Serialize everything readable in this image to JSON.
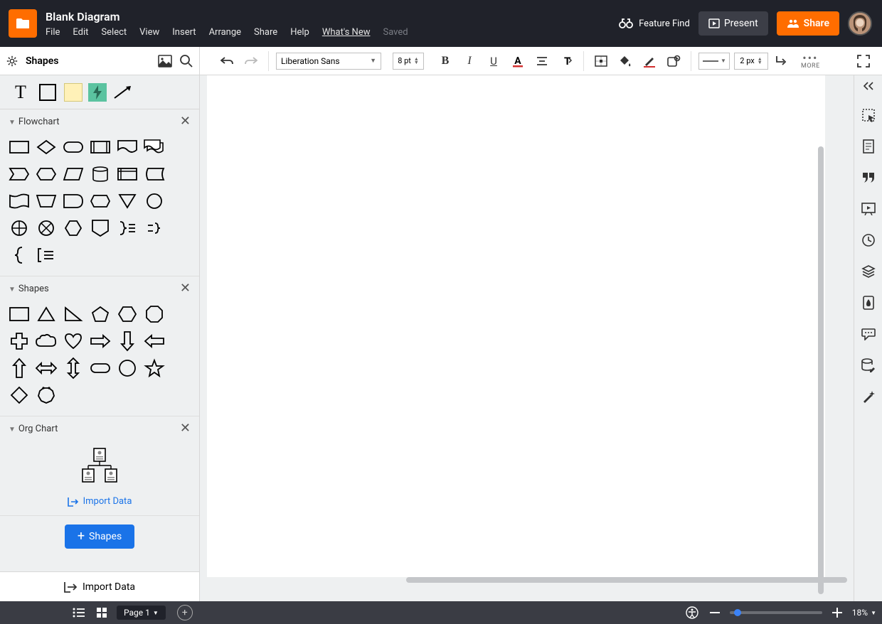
{
  "header": {
    "title": "Blank Diagram",
    "menus": [
      "File",
      "Edit",
      "Select",
      "View",
      "Insert",
      "Arrange",
      "Share",
      "Help",
      "What's New"
    ],
    "saved_label": "Saved",
    "feature_find": "Feature Find",
    "present": "Present",
    "share": "Share"
  },
  "toolbar": {
    "left_label": "Shapes",
    "font": "Liberation Sans",
    "font_size": "8 pt",
    "line_width": "2 px",
    "more_label": "MORE"
  },
  "quick_shapes": {
    "items": [
      "text",
      "rectangle",
      "note",
      "action",
      "arrow"
    ]
  },
  "categories": {
    "flowchart": {
      "title": "Flowchart",
      "shapes": [
        "process",
        "decision",
        "terminator",
        "predefined",
        "document",
        "multi-document",
        "off-page",
        "preparation",
        "data",
        "database",
        "internal-storage",
        "stored-data",
        "card",
        "manual-operation",
        "delay",
        "display",
        "triangle-down",
        "connector",
        "summing",
        "or",
        "hexagon-small",
        "shield",
        "brace-right-list",
        "brace-short",
        "brace-left",
        "bracket-list"
      ]
    },
    "shapes": {
      "title": "Shapes",
      "shapes": [
        "rectangle",
        "triangle",
        "right-triangle",
        "pentagon",
        "hexagon",
        "octagon",
        "cross",
        "cloud",
        "heart",
        "arrow-right",
        "arrow-down",
        "arrow-left",
        "arrow-up",
        "arrow-lr",
        "arrow-ud",
        "pill",
        "circle",
        "star",
        "diamond",
        "poly-badge"
      ]
    },
    "orgchart": {
      "title": "Org Chart",
      "import_link": "Import Data"
    }
  },
  "left_footer": {
    "shapes_btn": "Shapes",
    "import_data": "Import Data"
  },
  "right_rail": {
    "icons": [
      "collapse",
      "select-bounds",
      "page-settings",
      "quote",
      "present-slide",
      "history",
      "layers",
      "drop",
      "comment",
      "db-edit",
      "wand"
    ]
  },
  "footer": {
    "page_label": "Page 1",
    "zoom_pct": "18%"
  }
}
